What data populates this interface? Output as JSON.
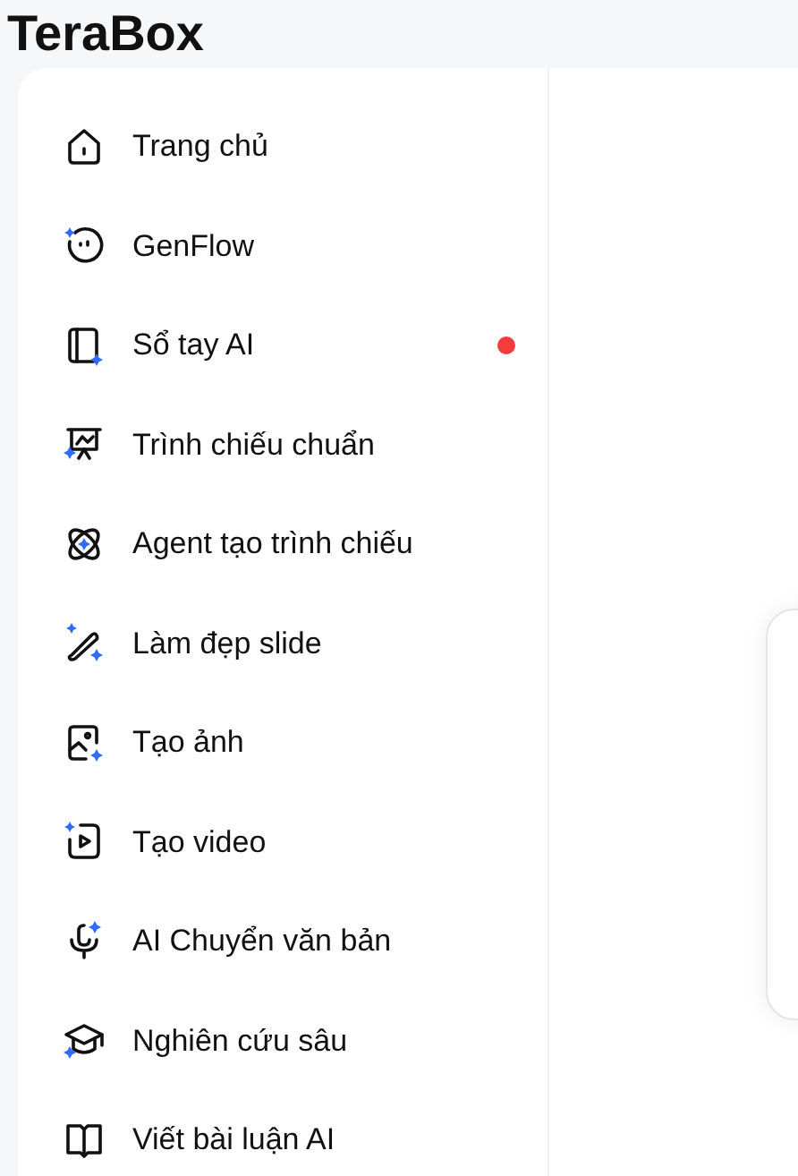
{
  "logo": {
    "text": "TeraBox"
  },
  "sidebar": {
    "items": [
      {
        "label": "Trang chủ",
        "notification_dot": false
      },
      {
        "label": "GenFlow",
        "notification_dot": false
      },
      {
        "label": "Sổ tay AI",
        "notification_dot": true
      },
      {
        "label": "Trình chiếu chuẩn",
        "notification_dot": false
      },
      {
        "label": "Agent tạo trình chiếu",
        "notification_dot": false
      },
      {
        "label": "Làm đẹp slide",
        "notification_dot": false
      },
      {
        "label": "Tạo ảnh",
        "notification_dot": false
      },
      {
        "label": "Tạo video",
        "notification_dot": false
      },
      {
        "label": "AI Chuyển văn bản",
        "notification_dot": false
      },
      {
        "label": "Nghiên cứu sâu",
        "notification_dot": false
      },
      {
        "label": "Viết bài luận AI",
        "notification_dot": false
      }
    ]
  }
}
